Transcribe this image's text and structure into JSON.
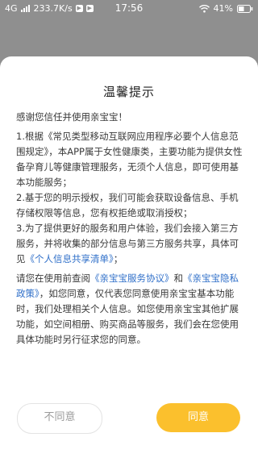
{
  "status_bar": {
    "network": "4G",
    "speed": "233.7K/s",
    "time": "17:56",
    "battery": "41%"
  },
  "dialog": {
    "title": "温馨提示",
    "intro": "感谢您信任并使用亲宝宝！",
    "item1": "1.根据《常见类型移动互联网应用程序必要个人信息范围规定》，本APP属于女性健康类，主要功能为提供女性备孕育儿等健康管理服务，无须个人信息，即可使用基本功能服务；",
    "item2": "2.基于您的明示授权，我们可能会获取设备信息、手机存储权限等信息，您有权拒绝或取消授权；",
    "item3_prefix": "3.为了提供更好的服务和用户体验，我们会接入第三方服务，并将收集的部分信息与第三方服务共享，具体可见",
    "item3_link": "《个人信息共享清单》",
    "item3_suffix": "；",
    "para_p1": "请您在使用前查阅",
    "para_link1": "《亲宝宝服务协议》",
    "para_and": "和",
    "para_link2": "《亲宝宝隐私政策》",
    "para_p2": "，如您同意，仅代表您同意使用亲宝宝基本功能时，我们处理相关个人信息。如您使用亲宝宝其他扩展功能，如空间相册、购买商品等服务，我们会在您使用具体功能时另行征求您的同意。",
    "disagree_label": "不同意",
    "agree_label": "同意"
  },
  "colors": {
    "accent": "#fbc02d",
    "link": "#2f6fc9"
  }
}
